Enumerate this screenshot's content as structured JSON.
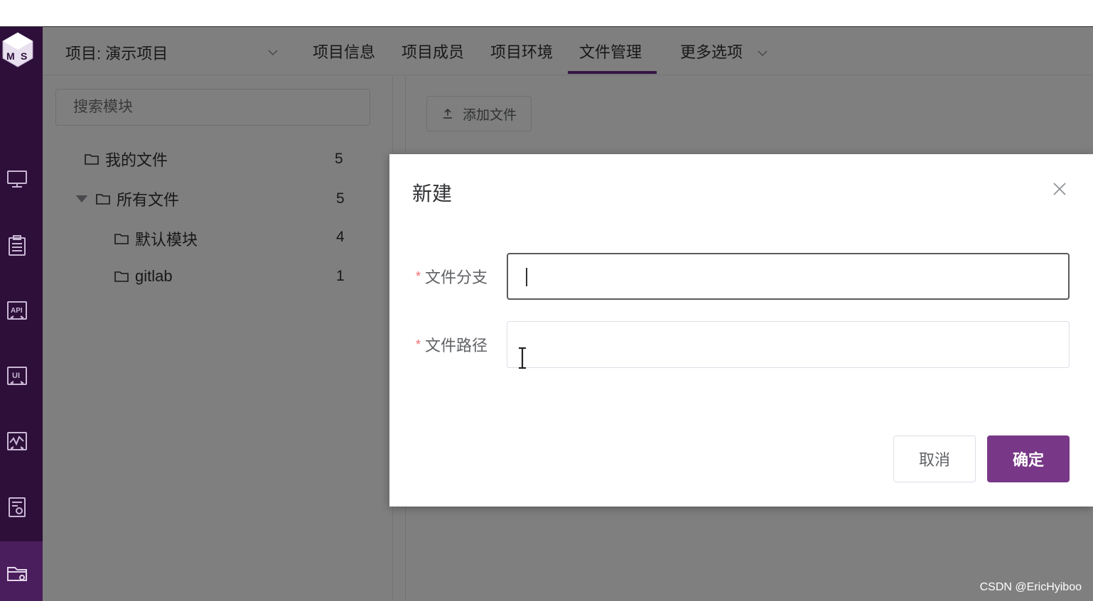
{
  "navbar": {
    "project_label": "项目: 演示项目",
    "tabs": [
      "项目信息",
      "项目成员",
      "项目环境",
      "文件管理",
      "更多选项"
    ],
    "active_tab": "文件管理"
  },
  "sidebar": {
    "logo_text": "MS",
    "icons": [
      "monitor-icon",
      "clipboard-icon",
      "api-icon",
      "ui-icon",
      "performance-icon",
      "report-icon",
      "project-folder-icon"
    ]
  },
  "left_panel": {
    "search_placeholder": "搜索模块",
    "tree": [
      {
        "label": "我的文件",
        "count": "5"
      },
      {
        "label": "所有文件",
        "count": "5"
      },
      {
        "label": "默认模块",
        "count": "4"
      },
      {
        "label": "gitlab",
        "count": "1"
      }
    ]
  },
  "right_panel": {
    "add_file_label": "添加文件"
  },
  "dialog": {
    "title": "新建",
    "fields": [
      {
        "label": "文件分支",
        "value": ""
      },
      {
        "label": "文件路径",
        "value": ""
      }
    ],
    "cancel_label": "取消",
    "confirm_label": "确定"
  },
  "watermark": "CSDN @EricHyiboo",
  "colors": {
    "sidebar": "#2d0f3a",
    "primary": "#783887",
    "required": "#f56c6c"
  }
}
